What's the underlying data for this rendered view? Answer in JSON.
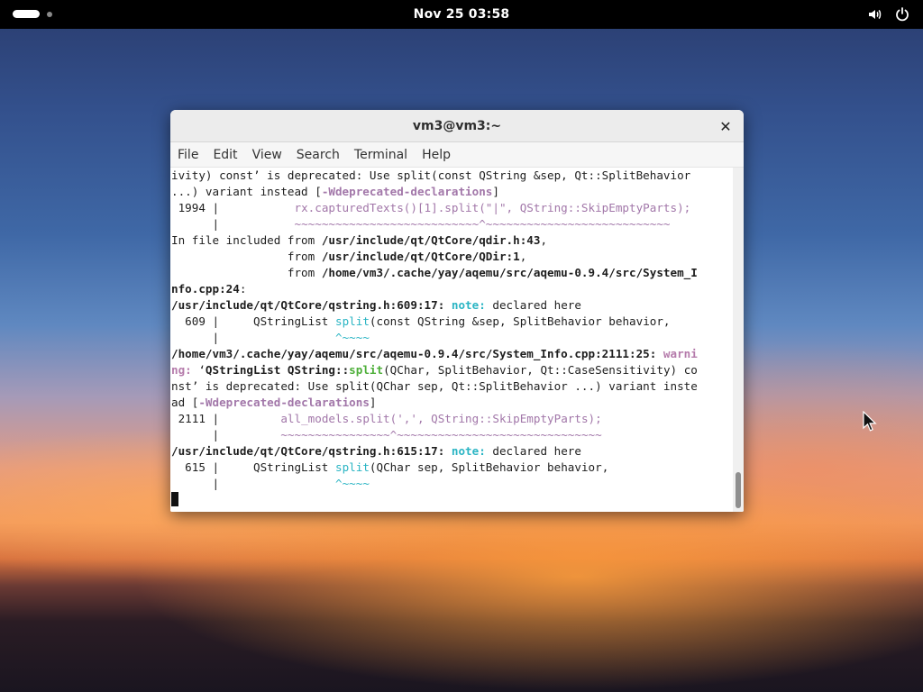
{
  "topbar": {
    "clock": "Nov 25  03:58",
    "icons": [
      "activities-pill",
      "workspace-dot",
      "volume-icon",
      "power-icon"
    ]
  },
  "window": {
    "title": "vm3@vm3:~",
    "close_glyph": "✕",
    "menu": [
      "File",
      "Edit",
      "View",
      "Search",
      "Terminal",
      "Help"
    ]
  },
  "terminal": {
    "lines": [
      [
        {
          "t": "ivity) const’ is deprecated: Use split(const QString &sep, Qt::SplitBehavior"
        }
      ],
      [
        {
          "t": "...) variant instead ["
        },
        {
          "t": "-Wdeprecated-declarations",
          "c": "purple-b"
        },
        {
          "t": "]"
        }
      ],
      [
        {
          "t": " 1994 |           "
        },
        {
          "t": "rx.capturedTexts()[1].split(\"|\", QString::SkipEmptyParts);",
          "c": "purple"
        }
      ],
      [
        {
          "t": "      |           "
        },
        {
          "t": "~~~~~~~~~~~~~~~~~~~~~~~~~~~^~~~~~~~~~~~~~~~~~~~~~~~~~~~",
          "c": "tilde"
        }
      ],
      [
        {
          "t": "In file included from "
        },
        {
          "t": "/usr/include/qt/QtCore/qdir.h:43",
          "c": "b"
        },
        {
          "t": ","
        }
      ],
      [
        {
          "t": "                 from "
        },
        {
          "t": "/usr/include/qt/QtCore/QDir:1",
          "c": "b"
        },
        {
          "t": ","
        }
      ],
      [
        {
          "t": "                 from "
        },
        {
          "t": "/home/vm3/.cache/yay/aqemu/src/aqemu-0.9.4/src/System_I",
          "c": "b"
        }
      ],
      [
        {
          "t": "nfo.cpp:24",
          "c": "b"
        },
        {
          "t": ":"
        }
      ],
      [
        {
          "t": "/usr/include/qt/QtCore/qstring.h:609:17:",
          "c": "b"
        },
        {
          "t": " "
        },
        {
          "t": "note:",
          "c": "note"
        },
        {
          "t": " declared here"
        }
      ],
      [
        {
          "t": "  609 |     QStringList "
        },
        {
          "t": "split",
          "c": "cyan"
        },
        {
          "t": "(const QString &sep, SplitBehavior behavior,"
        }
      ],
      [
        {
          "t": "      |                 "
        },
        {
          "t": "^~~~~",
          "c": "cyan"
        }
      ],
      [
        {
          "t": "/home/vm3/.cache/yay/aqemu/src/aqemu-0.9.4/src/System_Info.cpp:2111:25:",
          "c": "b"
        },
        {
          "t": " "
        },
        {
          "t": "warni",
          "c": "warn"
        }
      ],
      [
        {
          "t": "ng:",
          "c": "warn"
        },
        {
          "t": " ‘"
        },
        {
          "t": "QStringList QString::",
          "c": "b"
        },
        {
          "t": "split",
          "c": "green-b"
        },
        {
          "t": "(QChar, SplitBehavior, Qt::CaseSensitivity) co"
        }
      ],
      [
        {
          "t": "nst’ is deprecated: Use split(QChar sep, Qt::SplitBehavior ...) variant inste"
        }
      ],
      [
        {
          "t": "ad ["
        },
        {
          "t": "-Wdeprecated-declarations",
          "c": "purple-b"
        },
        {
          "t": "]"
        }
      ],
      [
        {
          "t": " 2111 |         "
        },
        {
          "t": "all_models.split(',', QString::SkipEmptyParts);",
          "c": "purple"
        }
      ],
      [
        {
          "t": "      |         "
        },
        {
          "t": "~~~~~~~~~~~~~~~~^~~~~~~~~~~~~~~~~~~~~~~~~~~~~~~",
          "c": "tilde"
        }
      ],
      [
        {
          "t": "/usr/include/qt/QtCore/qstring.h:615:17:",
          "c": "b"
        },
        {
          "t": " "
        },
        {
          "t": "note:",
          "c": "note"
        },
        {
          "t": " declared here"
        }
      ],
      [
        {
          "t": "  615 |     QStringList "
        },
        {
          "t": "split",
          "c": "cyan"
        },
        {
          "t": "(QChar sep, SplitBehavior behavior,"
        }
      ],
      [
        {
          "t": "      |                 "
        },
        {
          "t": "^~~~~",
          "c": "cyan"
        }
      ]
    ]
  },
  "scrollbar": {
    "position": 0.98
  }
}
